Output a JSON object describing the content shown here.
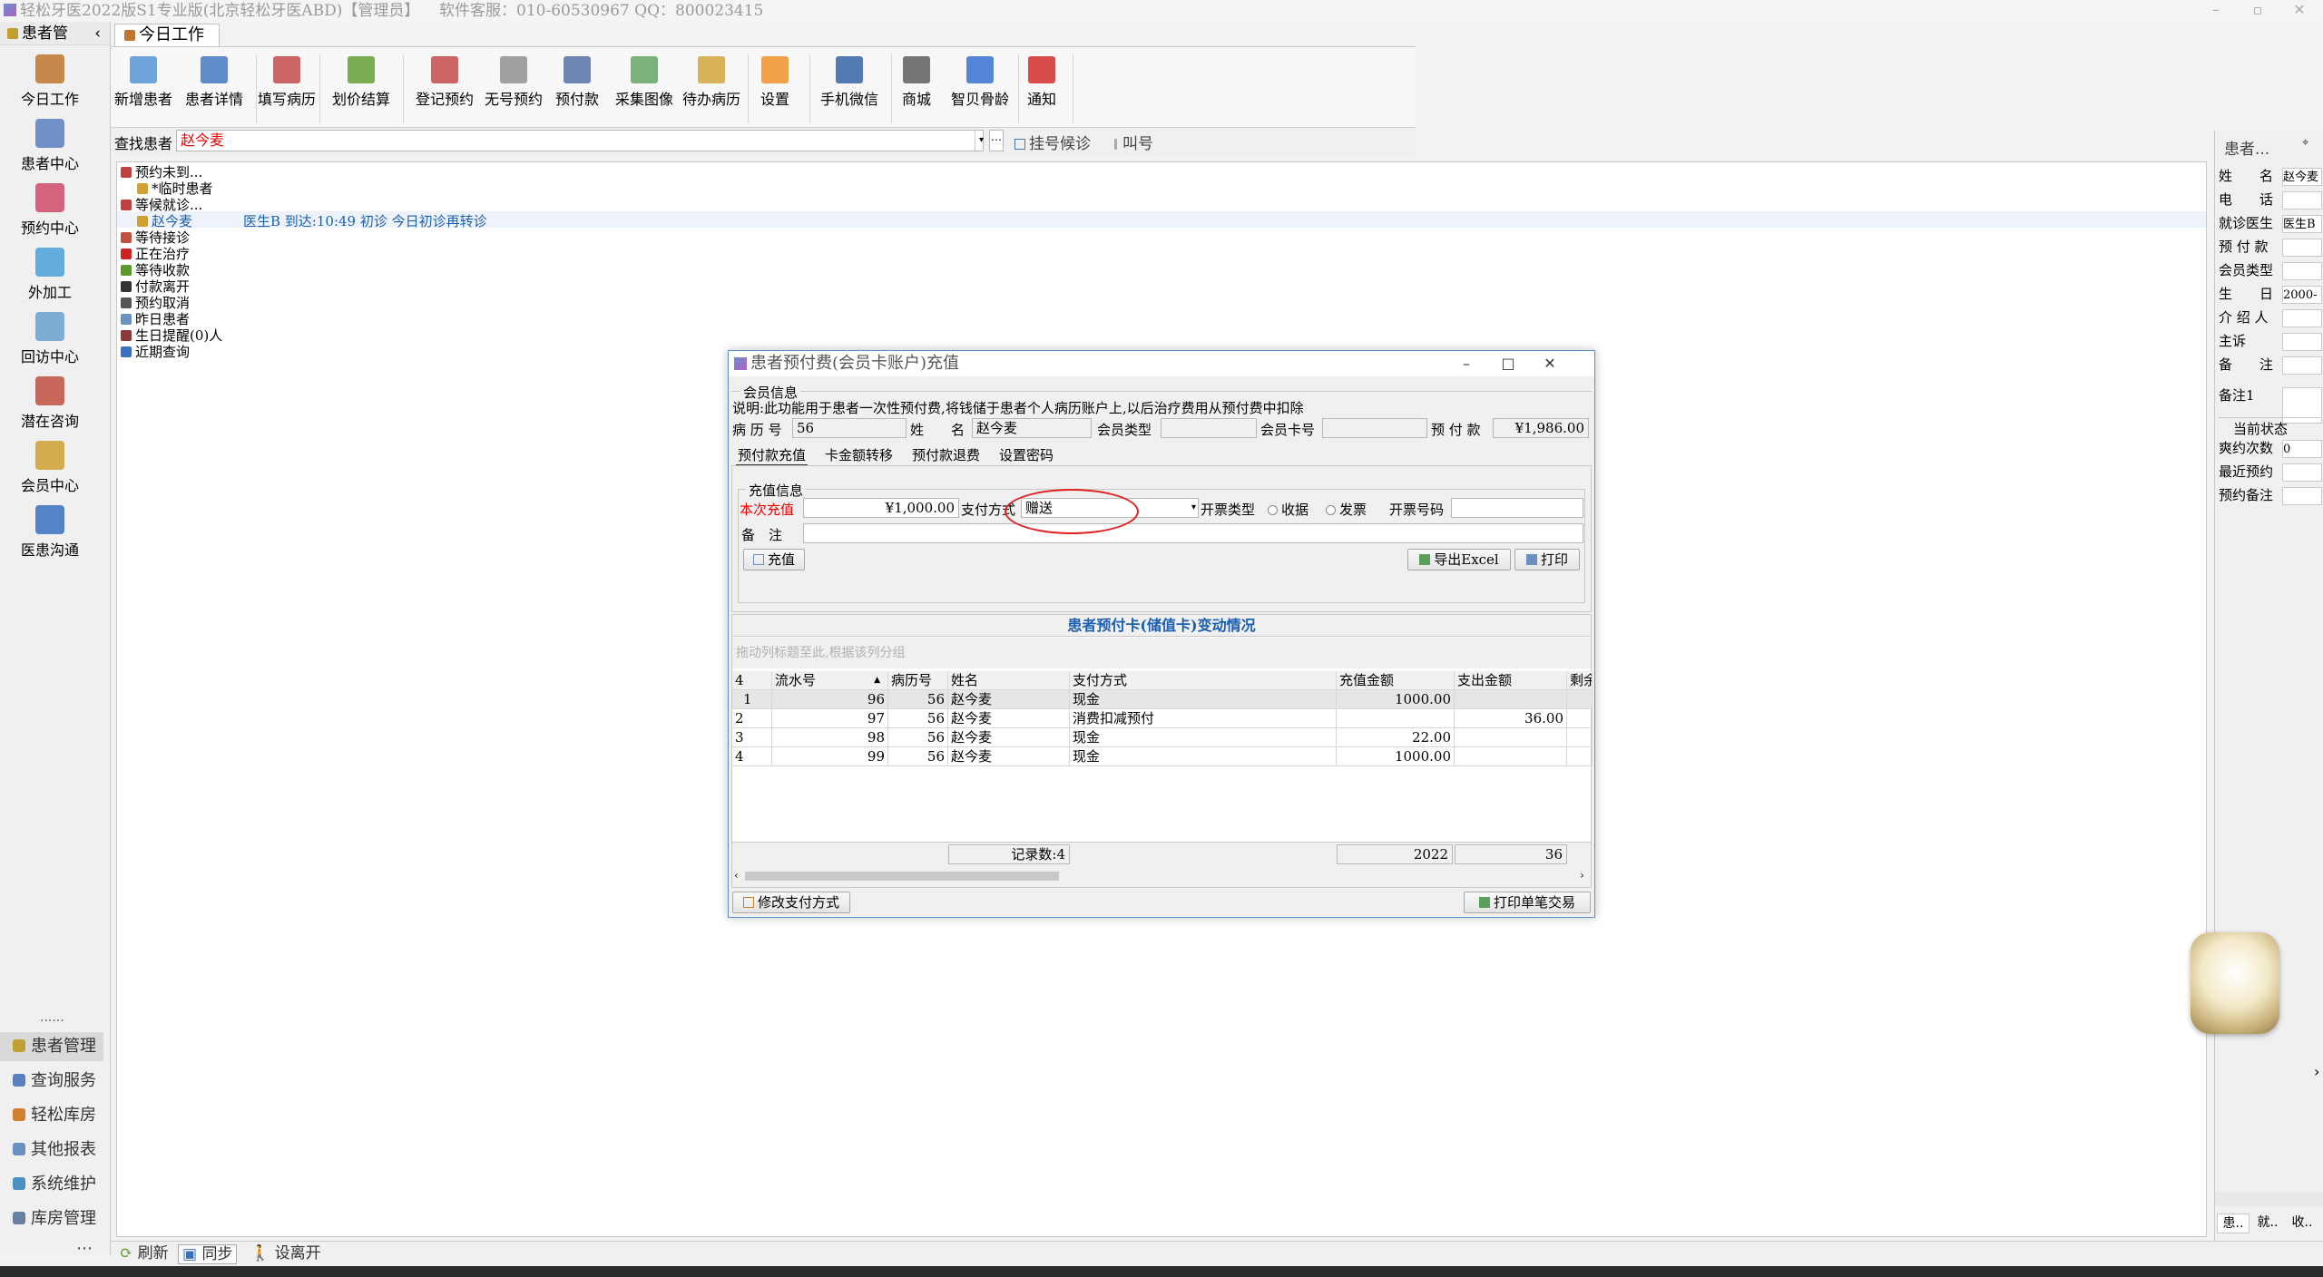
{
  "app": {
    "title": "轻松牙医2022版S1专业版(北京轻松牙医ABD)【管理员】",
    "service": "软件客服：010-60530967 QQ：800023415"
  },
  "sidebar": {
    "header": "患者管",
    "items": [
      {
        "label": "今日工作",
        "icon": "desk-person-icon",
        "color": "#c0762e"
      },
      {
        "label": "患者中心",
        "icon": "patients-icon",
        "color": "#5b7fbf"
      },
      {
        "label": "预约中心",
        "icon": "calendar-icon",
        "color": "#d04a6a"
      },
      {
        "label": "外加工",
        "icon": "boxes-icon",
        "color": "#4aa0d8"
      },
      {
        "label": "回访中心",
        "icon": "refresh-icon",
        "color": "#6aa0d0"
      },
      {
        "label": "潜在咨询",
        "icon": "consult-icon",
        "color": "#c05040"
      },
      {
        "label": "会员中心",
        "icon": "members-icon",
        "color": "#d0a030"
      },
      {
        "label": "医患沟通",
        "icon": "film-icon",
        "color": "#3a70c0"
      }
    ],
    "more": "......",
    "modules": [
      {
        "label": "患者管理",
        "color": "#c0a030"
      },
      {
        "label": "查询服务",
        "color": "#5b7fbf"
      },
      {
        "label": "轻松库房",
        "color": "#d08030"
      },
      {
        "label": "其他报表",
        "color": "#6a8fc0"
      },
      {
        "label": "系统维护",
        "color": "#4a90c0"
      },
      {
        "label": "库房管理",
        "color": "#6a80a0"
      }
    ],
    "ellipsis": "⋯"
  },
  "tab": {
    "label": "今日工作"
  },
  "toolbar": {
    "buttons": [
      {
        "label": "新增患者",
        "icon": "add-patient-icon",
        "color": "#4a90d0"
      },
      {
        "label": "患者详情",
        "icon": "patient-detail-icon",
        "color": "#3a70c0"
      },
      {
        "label": "填写病历",
        "icon": "medical-record-icon",
        "color": "#c04040"
      },
      {
        "label": "划价结算",
        "icon": "yen-icon",
        "color": "#5a9a2a"
      },
      {
        "label": "登记预约",
        "icon": "register-appointment-icon",
        "color": "#c04040"
      },
      {
        "label": "无号预约",
        "icon": "calendar-grid-icon",
        "color": "#8a8a8a"
      },
      {
        "label": "预付款",
        "icon": "prepay-icon",
        "color": "#4a6aa0"
      },
      {
        "label": "采集图像",
        "icon": "image-icon",
        "color": "#5aa05a"
      },
      {
        "label": "待办病历",
        "icon": "todo-icon",
        "color": "#d0a030"
      },
      {
        "label": "设置",
        "icon": "rss-icon",
        "color": "#f08a1a"
      },
      {
        "label": "手机微信",
        "icon": "phone-icon",
        "color": "#2a5aa0"
      },
      {
        "label": "商城",
        "icon": "cart-icon",
        "color": "#555555"
      },
      {
        "label": "智贝骨龄",
        "icon": "bone-age-icon",
        "color": "#2a6ad0"
      },
      {
        "label": "通知",
        "icon": "alert-icon",
        "color": "#d02020"
      }
    ]
  },
  "search": {
    "label": "查找患者",
    "value": "赵今麦",
    "more": "⋯",
    "register_label": "挂号候诊",
    "call_label": "叫号"
  },
  "tree": {
    "nodes": [
      {
        "label": "预约未到..."
      },
      {
        "label": "*临时患者"
      },
      {
        "label": "等候就诊..."
      },
      {
        "label": "赵今麦",
        "detail": "医生B 到达:10:49 初诊 今日初诊再转诊"
      },
      {
        "label": "等待接诊"
      },
      {
        "label": "正在治疗"
      },
      {
        "label": "等待收款"
      },
      {
        "label": "付款离开"
      },
      {
        "label": "预约取消"
      },
      {
        "label": "昨日患者"
      },
      {
        "label": "生日提醒(0)人"
      },
      {
        "label": "近期查询"
      }
    ]
  },
  "right_panel": {
    "title": "患者...",
    "pin": "⌖",
    "fields": [
      {
        "label": "姓　　名",
        "value": "赵今麦"
      },
      {
        "label": "电　　话",
        "value": ""
      },
      {
        "label": "就诊医生",
        "value": "医生B"
      },
      {
        "label": "预 付 款",
        "value": ""
      },
      {
        "label": "会员类型",
        "value": ""
      },
      {
        "label": "生　　日",
        "value": "2000-"
      },
      {
        "label": "介 绍 人",
        "value": ""
      },
      {
        "label": "主诉",
        "value": ""
      },
      {
        "label": "备　　注",
        "value": ""
      },
      {
        "label": "备注1",
        "value": ""
      }
    ],
    "state_title": "当前状态",
    "state_fields": [
      {
        "label": "爽约次数",
        "value": "0"
      },
      {
        "label": "最近预约",
        "value": ""
      },
      {
        "label": "预约备注",
        "value": ""
      }
    ],
    "bottom_tabs": [
      "患..",
      "就..",
      "收.."
    ]
  },
  "statusbar": {
    "refresh": "刷新",
    "sync": "同步",
    "leave": "设离开"
  },
  "dialog": {
    "title": "患者预付费(会员卡账户)充值",
    "member_legend": "会员信息",
    "note": "说明:此功能用于患者一次性预付费,将钱储于患者个人病历账户上,以后治疗费用从预付费中扣除",
    "fields": {
      "record_no_label": "病 历 号",
      "record_no": "56",
      "name_label": "姓　　名",
      "name": "赵今麦",
      "member_type_label": "会员类型",
      "member_type": "",
      "card_no_label": "会员卡号",
      "card_no": "",
      "prepay_label": "预 付 款",
      "prepay": "¥1,986.00"
    },
    "tabs": [
      "预付款充值",
      "卡金额转移",
      "预付款退费",
      "设置密码"
    ],
    "recharge_legend": "充值信息",
    "amount_label": "本次充值",
    "amount": "¥1,000.00",
    "pay_method_label": "支付方式",
    "pay_method": "赠送",
    "invoice_type_label": "开票类型",
    "invoice_options": [
      "收据",
      "发票"
    ],
    "invoice_no_label": "开票号码",
    "invoice_no": "",
    "remark_label": "备　注",
    "remark": "",
    "recharge_button": "充值",
    "export_button": "导出Excel",
    "print_button": "打印",
    "grid": {
      "caption": "患者预付卡(储值卡)变动情况",
      "group_hint": "拖动列标题至此,根据该列分组",
      "row_count": "4",
      "columns": [
        "流水号",
        "病历号",
        "姓名",
        "支付方式",
        "充值金额",
        "支出金额",
        "剩余"
      ],
      "rows": [
        {
          "idx": "1",
          "serial": "96",
          "record": "56",
          "name": "赵今麦",
          "method": "现金",
          "charge": "1000.00",
          "spend": ""
        },
        {
          "idx": "2",
          "serial": "97",
          "record": "56",
          "name": "赵今麦",
          "method": "消费扣减预付",
          "charge": "",
          "spend": "36.00"
        },
        {
          "idx": "3",
          "serial": "98",
          "record": "56",
          "name": "赵今麦",
          "method": "现金",
          "charge": "22.00",
          "spend": ""
        },
        {
          "idx": "4",
          "serial": "99",
          "record": "56",
          "name": "赵今麦",
          "method": "现金",
          "charge": "1000.00",
          "spend": ""
        }
      ],
      "footer_count": "记录数:4",
      "footer_charge": "2022",
      "footer_spend": "36"
    },
    "modify_button": "修改支付方式",
    "print_single_button": "打印单笔交易"
  }
}
